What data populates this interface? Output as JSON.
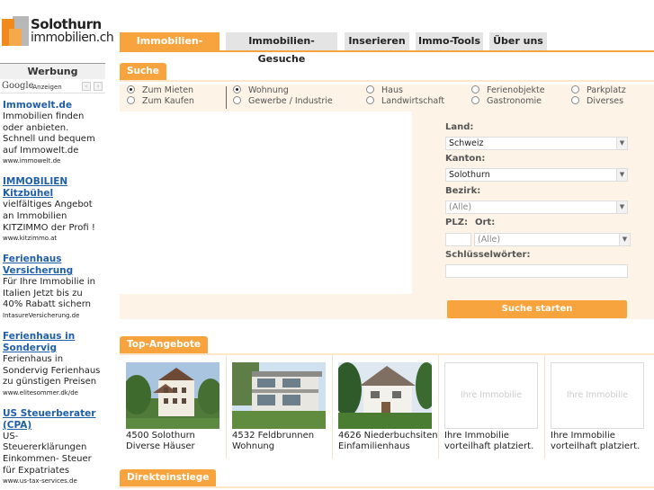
{
  "logo": {
    "line1": "Solothurn",
    "line2": "immobilien.ch"
  },
  "sidebar": {
    "heading": "Werbung",
    "google": "Google",
    "anzeigen": "-Anzeigen",
    "prev": "‹",
    "next": "›",
    "ads": [
      {
        "title": "Immowelt.de",
        "desc": "Immobilien finden oder anbieten. Schnell und bequem auf Immowelt.de",
        "url": "www.immowelt.de"
      },
      {
        "title": "IMMOBILIEN Kitzbühel",
        "desc": "vielfältiges Angebot an Immobilien KITZIMMO der Profi !",
        "url": "www.kitzimmo.at"
      },
      {
        "title": "Ferienhaus Versicherung",
        "desc": "Für Ihre Immobilie in Italien Jetzt bis zu 40% Rabatt sichern",
        "url": "IntasureVersicherung.de"
      },
      {
        "title": "Ferienhaus in Sondervig",
        "desc": "Ferienhaus in Sondervig Ferienhaus zu günstigen Preisen",
        "url": "www.elitesommer.dk/de"
      },
      {
        "title": "US Steuerberater (CPA)",
        "desc": "US- Steuererklärungen Einkommen- Steuer für Expatriates",
        "url": "www.us-tax-services.de"
      }
    ]
  },
  "tabs": [
    "Immobilien-Suche",
    "Immobilien-Gesuche",
    "Inserieren",
    "Immo-Tools",
    "Über uns"
  ],
  "search": {
    "header": "Suche",
    "mode": [
      "Zum Mieten",
      "Zum Kaufen"
    ],
    "types": [
      "Wohnung",
      "Gewerbe / Industrie",
      "Haus",
      "Landwirtschaft",
      "Ferienobjekte",
      "Gastronomie",
      "Parkplatz",
      "Diverses"
    ],
    "land_label": "Land:",
    "land_value": "Schweiz",
    "kanton_label": "Kanton:",
    "kanton_value": "Solothurn",
    "bezirk_label": "Bezirk:",
    "bezirk_value": "(Alle)",
    "plz_label": "PLZ:",
    "ort_label": "Ort:",
    "ort_value": "(Alle)",
    "keywords_label": "Schlüsselwörter:",
    "submit": "Suche starten"
  },
  "top": {
    "header": "Top-Angebote",
    "offers": [
      {
        "line1": "4500 Solothurn",
        "line2": "Diverse Häuser"
      },
      {
        "line1": "4532 Feldbrunnen",
        "line2": "Wohnung"
      },
      {
        "line1": "4626 Niederbuchsiten",
        "line2": "Einfamilienhaus"
      },
      {
        "placeholder": "Ihre Immobilie",
        "line1": "Ihre Immobilie",
        "line2": "vorteilhaft platziert."
      },
      {
        "placeholder": "Ihre Immobilie",
        "line1": "Ihre Immobilie",
        "line2": "vorteilhaft platziert."
      }
    ]
  },
  "direkt": {
    "header": "Direkteinstiege"
  },
  "colors": {
    "accent": "#f7a43e",
    "panel": "#fdf3e6",
    "link": "#1f5fa8"
  }
}
